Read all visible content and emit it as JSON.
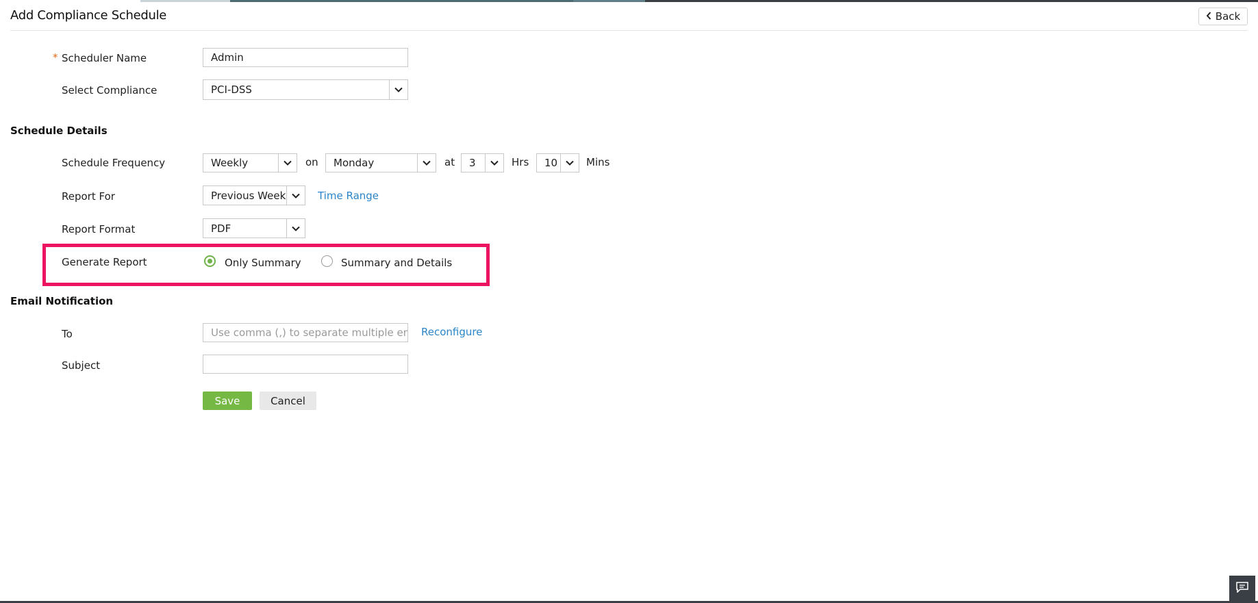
{
  "header": {
    "title": "Add Compliance Schedule",
    "back_label": "Back"
  },
  "form": {
    "scheduler_name_label": "Scheduler Name",
    "scheduler_name_value": "Admin",
    "required_mark": "*",
    "select_compliance_label": "Select Compliance",
    "select_compliance_value": "PCI-DSS"
  },
  "schedule": {
    "section_title": "Schedule Details",
    "frequency_label": "Schedule Frequency",
    "frequency_value": "Weekly",
    "on_text": "on",
    "day_value": "Monday",
    "at_text": "at",
    "hours_value": "3",
    "hrs_text": "Hrs",
    "minutes_value": "10",
    "mins_text": "Mins",
    "report_for_label": "Report For",
    "report_for_value": "Previous Week",
    "time_range_link": "Time Range",
    "report_format_label": "Report Format",
    "report_format_value": "PDF",
    "generate_report_label": "Generate Report",
    "options": [
      {
        "label": "Only Summary",
        "selected": true
      },
      {
        "label": "Summary and Details",
        "selected": false
      }
    ]
  },
  "email": {
    "section_title": "Email Notification",
    "to_label": "To",
    "to_placeholder": "Use comma (,) to separate multiple emails",
    "reconfigure_link": "Reconfigure",
    "subject_label": "Subject",
    "subject_value": ""
  },
  "actions": {
    "save_label": "Save",
    "cancel_label": "Cancel"
  },
  "colors": {
    "accent_green": "#75b843",
    "link_blue": "#2a86c9",
    "highlight_pink": "#ec1461",
    "required_orange": "#e06a1b"
  },
  "icons": {
    "back": "chevron-left-icon",
    "dropdown": "chevron-down-icon",
    "chat": "chat-icon"
  }
}
